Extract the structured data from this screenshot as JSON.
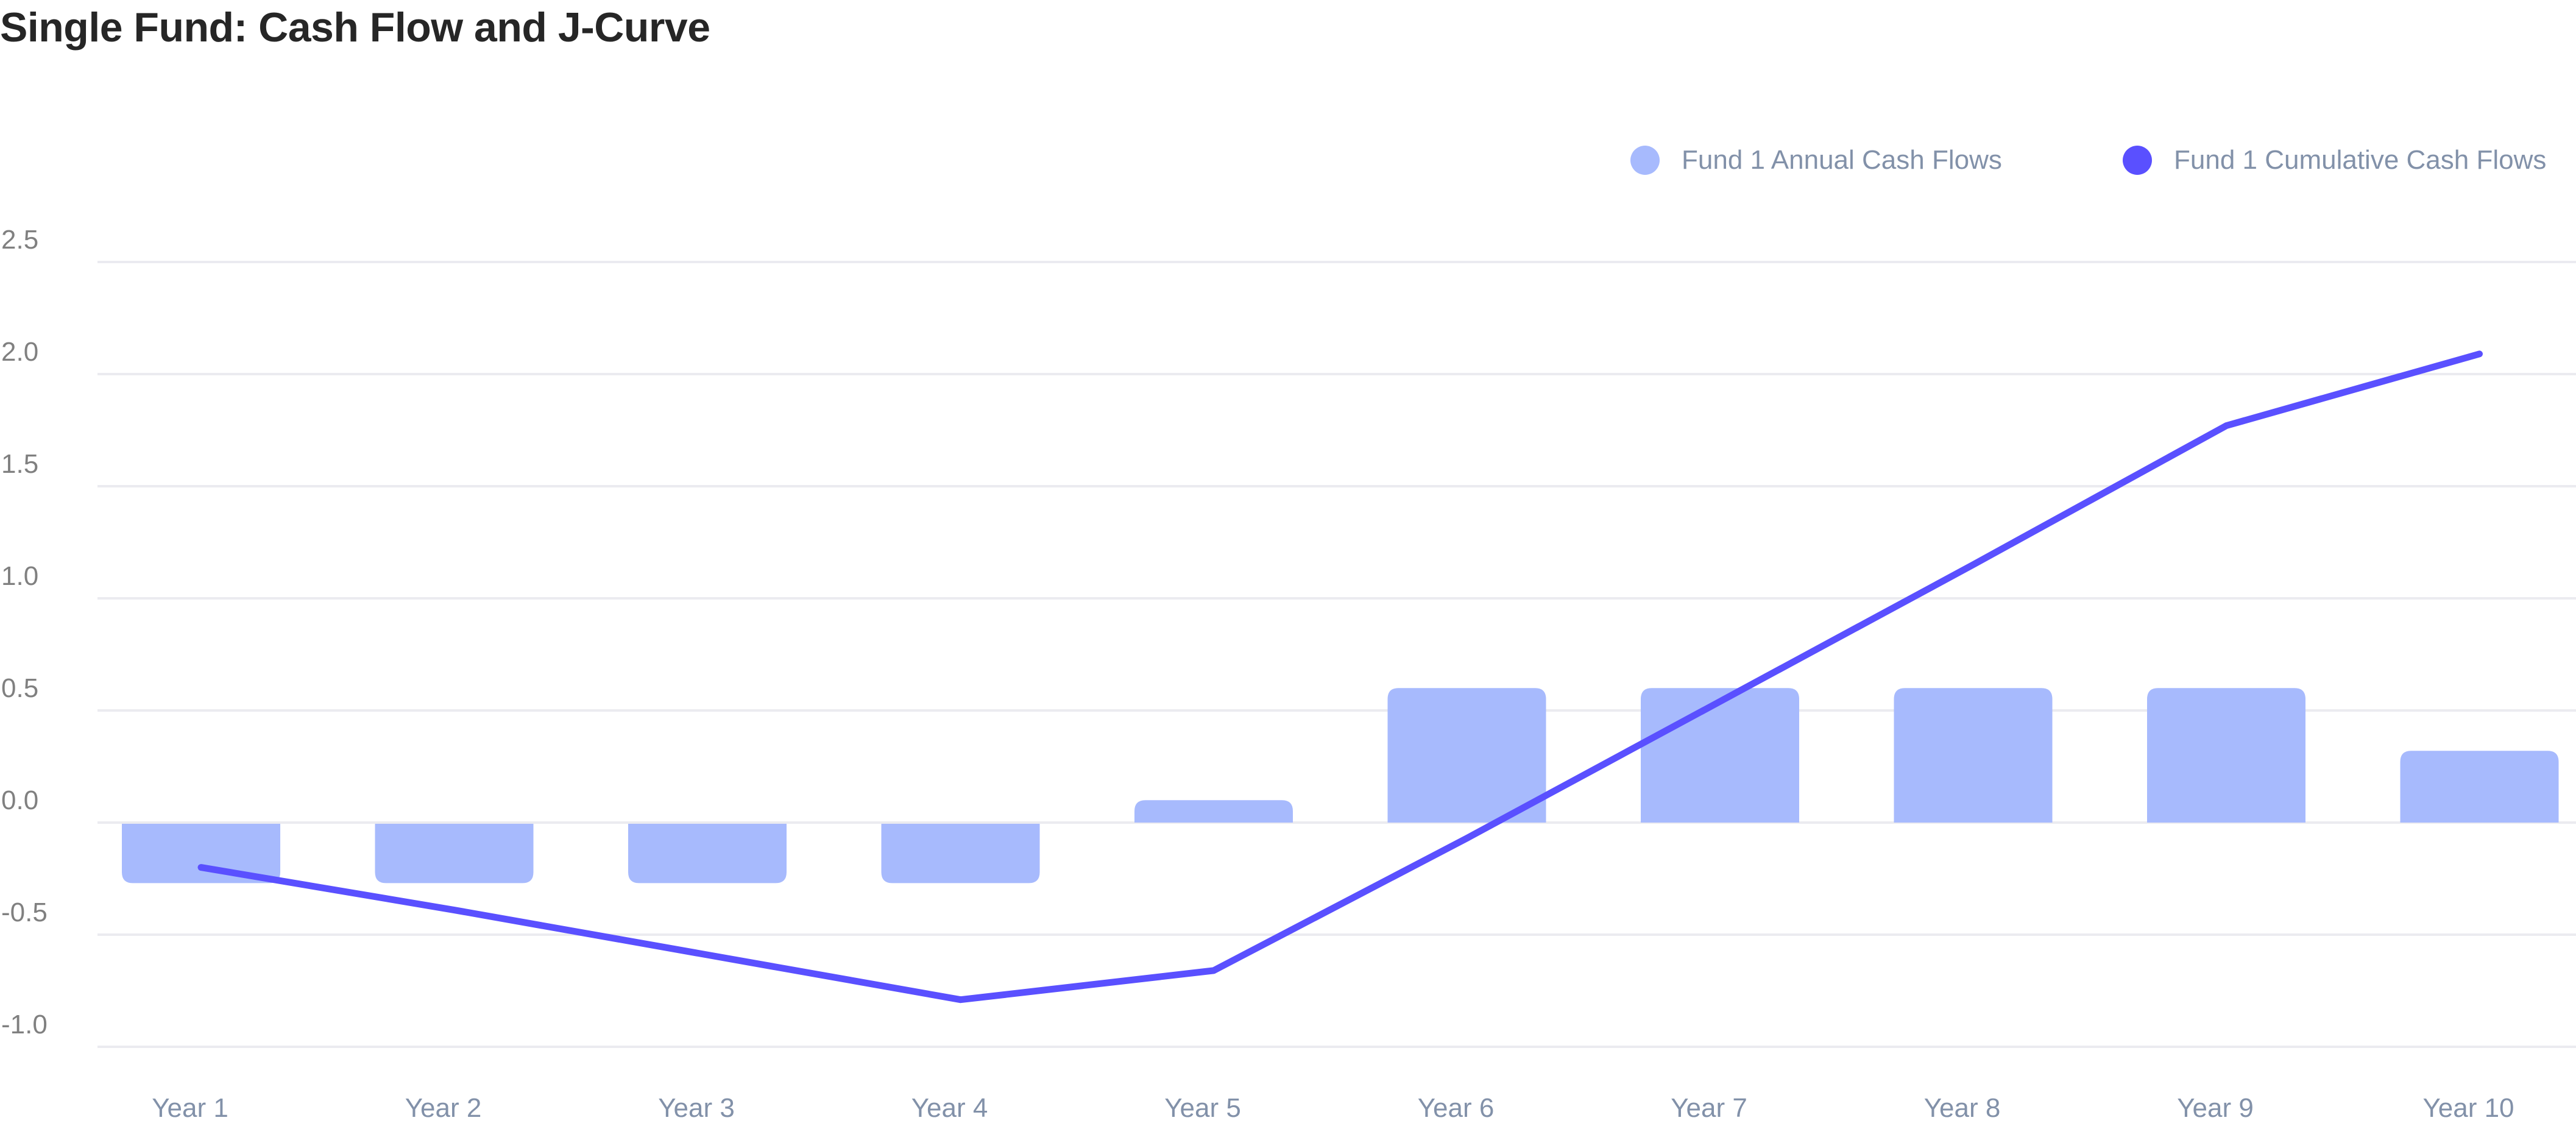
{
  "chart_data": {
    "type": "bar",
    "title": "Single Fund: Cash Flow and J-Curve",
    "xlabel": "",
    "ylabel": "",
    "categories": [
      "Year 1",
      "Year 2",
      "Year 3",
      "Year 4",
      "Year 5",
      "Year 6",
      "Year 7",
      "Year 8",
      "Year 9",
      "Year 10"
    ],
    "ylim": [
      -1.0,
      2.5
    ],
    "yticks": [
      2.5,
      2.0,
      1.5,
      1.0,
      0.5,
      0.0,
      -0.5,
      -1.0
    ],
    "ytick_labels": [
      "2.5",
      "2.0",
      "1.5",
      "1.0",
      "0.5",
      "0.0",
      "-0.5",
      "-1.0"
    ],
    "grid": true,
    "legend_position": "top-right",
    "series": [
      {
        "name": "Fund 1 Annual Cash Flows",
        "type": "bar",
        "color": "#A7BAFD",
        "values": [
          -0.27,
          -0.27,
          -0.27,
          -0.27,
          0.1,
          0.6,
          0.6,
          0.6,
          0.6,
          0.32
        ]
      },
      {
        "name": "Fund 1 Cumulative Cash Flows",
        "type": "line",
        "color": "#5A50FF",
        "values": [
          -0.2,
          -0.39,
          -0.59,
          -0.79,
          -0.66,
          -0.07,
          0.54,
          1.15,
          1.77,
          2.09
        ]
      }
    ]
  },
  "colors": {
    "title": "#262626",
    "axis_text": "#808080",
    "category_text": "#8291A9",
    "gridline": "#EBEBF0"
  }
}
